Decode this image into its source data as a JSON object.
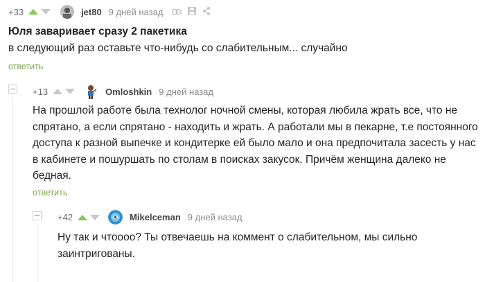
{
  "comments": [
    {
      "rating": "+33",
      "author": "jet80",
      "time": "9 дней назад",
      "title": "Юля заваривает сразу 2 пакетика",
      "text": "в следующий раз оставьте что-нибудь со слабительным... случайно",
      "reply_label": "ответить"
    },
    {
      "rating": "+13",
      "author": "Omloshkin",
      "time": "9 дней назад",
      "text_lines": [
        "На прошлой работе была технолог ночной смены, которая любила жрать все, что не",
        "спрятано, а если спрятано - находить и жрать. А работали мы в пекарне, т.е постоянного",
        "доступа к разной выпечке и кондитерке ей было мало и она предпочитала засесть у нас",
        "в кабинете и пошуршать по столам в поисках закусок. Причём женщина далеко не",
        "бедная."
      ],
      "reply_label": "ответить"
    },
    {
      "rating": "+42",
      "author": "Mikelceman",
      "time": "9 дней назад",
      "text_lines": [
        "Ну так и чтоооо? Ты отвечаешь на коммент о слабительном, мы сильно",
        "заинтригованы."
      ]
    }
  ],
  "colors": {
    "upvote": "#8ac858",
    "downvote": "#c8c8c8",
    "reply_link": "#7fa64f",
    "meta_text": "#8a8a8a"
  },
  "icons": [
    "link-icon",
    "save-icon",
    "share-icon"
  ]
}
